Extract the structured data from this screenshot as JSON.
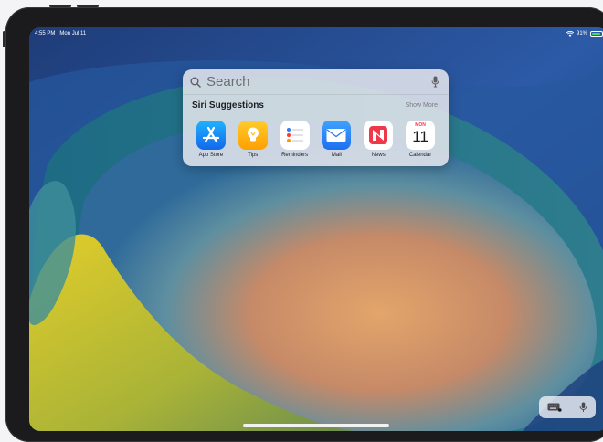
{
  "status_bar": {
    "time": "4:55 PM",
    "date": "Mon Jul 11",
    "battery": "91%",
    "battery_level": 0.91
  },
  "search": {
    "placeholder": "Search",
    "value": ""
  },
  "siri_suggestions": {
    "title": "Siri Suggestions",
    "show_more": "Show More",
    "apps": [
      {
        "label": "App Store",
        "icon": "app-store-icon",
        "color": "#1a8cff"
      },
      {
        "label": "Tips",
        "icon": "tips-icon",
        "color": "#ffb000"
      },
      {
        "label": "Reminders",
        "icon": "reminders-icon",
        "color": "#ffffff"
      },
      {
        "label": "Mail",
        "icon": "mail-icon",
        "color": "#2f7cf6"
      },
      {
        "label": "News",
        "icon": "news-icon",
        "color": "#f0384b"
      },
      {
        "label": "Calendar",
        "icon": "calendar-icon",
        "color": "#ffffff",
        "month": "MON",
        "day": "11"
      }
    ]
  },
  "colors": {
    "wallpaper_blue": "#2c4f8c",
    "wallpaper_orange": "#d99a5a",
    "wallpaper_yellow": "#d9c21a"
  }
}
